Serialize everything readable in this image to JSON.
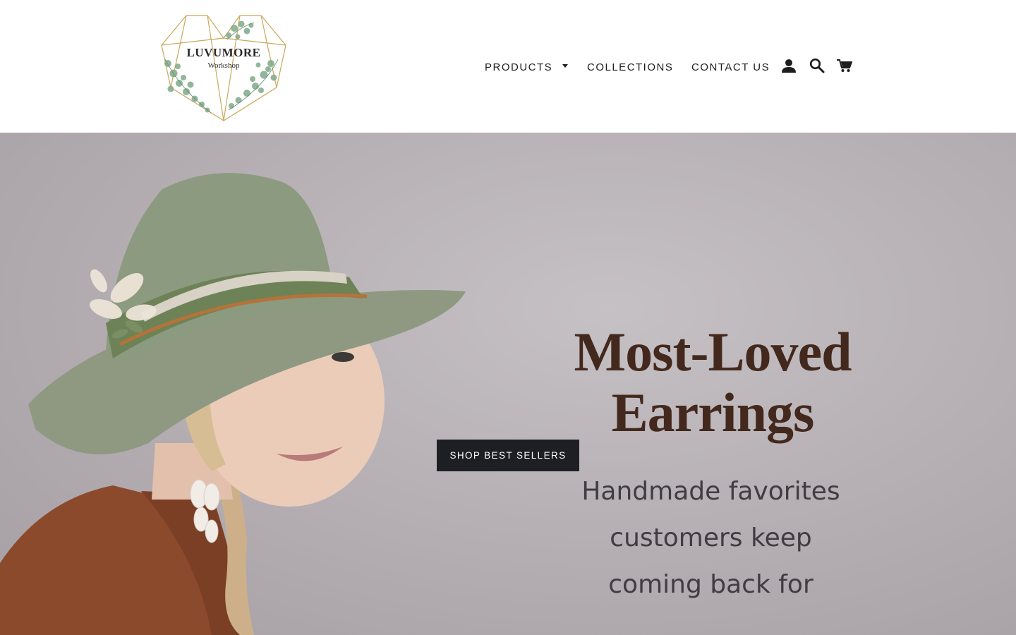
{
  "brand": {
    "name": "LUVUMORE",
    "subtitle": "Workshop"
  },
  "nav": {
    "items": [
      {
        "label": "Products",
        "has_dropdown": true
      },
      {
        "label": "Collections",
        "has_dropdown": false
      },
      {
        "label": "Contact Us",
        "has_dropdown": false
      }
    ]
  },
  "header_icons": {
    "account": "account-icon",
    "search": "search-icon",
    "cart": "cart-icon"
  },
  "hero": {
    "headline_line1": "Most-Loved",
    "headline_line2": "Earrings",
    "sub_line1": "Handmade favorites",
    "sub_line2": "customers keep",
    "sub_line3": "coming back for",
    "cta_label": "Shop Best Sellers"
  },
  "colors": {
    "headline": "#43291d",
    "cta_background": "#1e1f22",
    "hero_background": "#b7b1b5",
    "logo_gold": "#c9a85a",
    "logo_leaf": "#7fa98a"
  }
}
